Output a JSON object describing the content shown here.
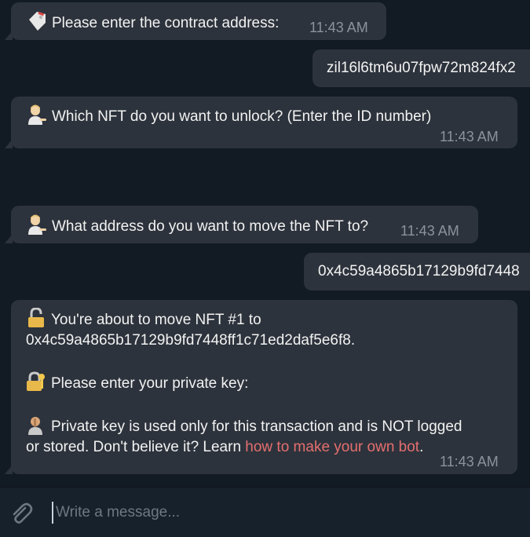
{
  "messages": [
    {
      "text": "Please enter the contract address:",
      "time": "11:43 AM",
      "emoji": "tag-icon"
    },
    {
      "text": "zil16l6tm6u07fpw72m824fx2"
    },
    {
      "text": "Which NFT do you want to unlock? (Enter the ID number)",
      "time": "11:43 AM",
      "emoji": "person-pointing-icon"
    },
    {
      "text": "What address do you want to move the NFT to?",
      "time": "11:43 AM",
      "emoji": "person-pointing-icon"
    },
    {
      "text": "0x4c59a4865b17129b9fd7448"
    },
    {
      "line1": "You're about to move NFT #1 to",
      "line2": "0x4c59a4865b17129b9fd7448ff1c71ed2daf5e6f8.",
      "line3": "Please enter your private key:",
      "line4": "Private key is used only for this transaction and is NOT logged",
      "line5a": "or stored. Don't believe it? Learn ",
      "link": "how to make your own bot",
      "line5b": ".",
      "time": "11:43 AM"
    }
  ],
  "composer": {
    "placeholder": "Write a message..."
  },
  "colors": {
    "background": "#121a23",
    "bubble": "#2d333c",
    "link": "#e46f6f",
    "time": "#8a939d"
  }
}
